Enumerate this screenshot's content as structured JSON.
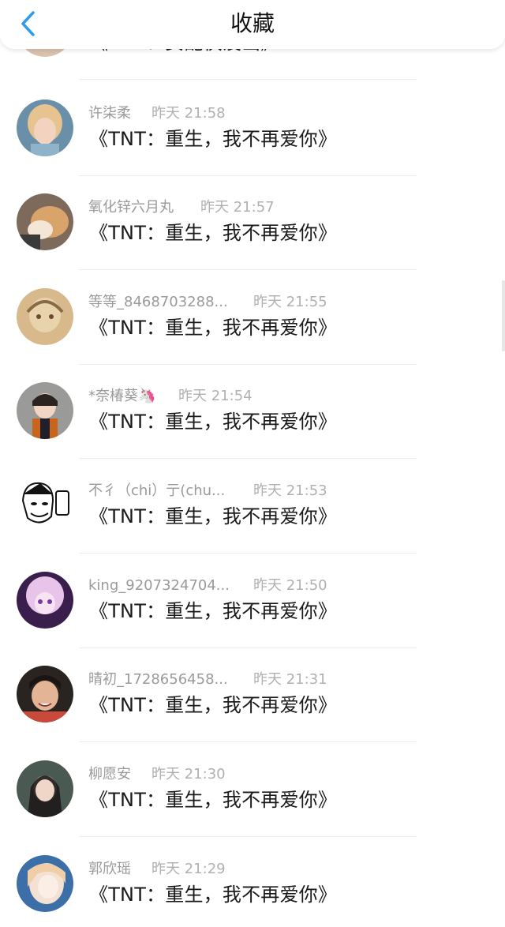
{
  "header": {
    "title": "收藏",
    "back_icon": "chevron-left-icon"
  },
  "accent_color": "#2d9cef",
  "items": [
    {
      "name": "",
      "time": "",
      "content": "《TNT：女配快没出》"
    },
    {
      "name": "许柒柔",
      "time": "昨天 21:58",
      "content": "《TNT：重生，我不再爱你》"
    },
    {
      "name": "氧化锌六月丸",
      "time": "昨天 21:57",
      "content": "《TNT：重生，我不再爱你》"
    },
    {
      "name": "等等_8468703288...",
      "time": "昨天 21:55",
      "content": "《TNT：重生，我不再爱你》"
    },
    {
      "name": "*奈椿葵🦄",
      "time": "昨天 21:54",
      "content": "《TNT：重生，我不再爱你》"
    },
    {
      "name": "不彳（chi）亍(chu...",
      "time": "昨天 21:53",
      "content": "《TNT：重生，我不再爱你》"
    },
    {
      "name": "king_9207324704...",
      "time": "昨天 21:50",
      "content": "《TNT：重生，我不再爱你》"
    },
    {
      "name": "晴初_1728656458...",
      "time": "昨天 21:31",
      "content": "《TNT：重生，我不再爱你》"
    },
    {
      "name": "柳愿安",
      "time": "昨天 21:30",
      "content": "《TNT：重生，我不再爱你》"
    },
    {
      "name": "郭欣瑶",
      "time": "昨天 21:29",
      "content": "《TNT：重生，我不再爱你》"
    }
  ]
}
